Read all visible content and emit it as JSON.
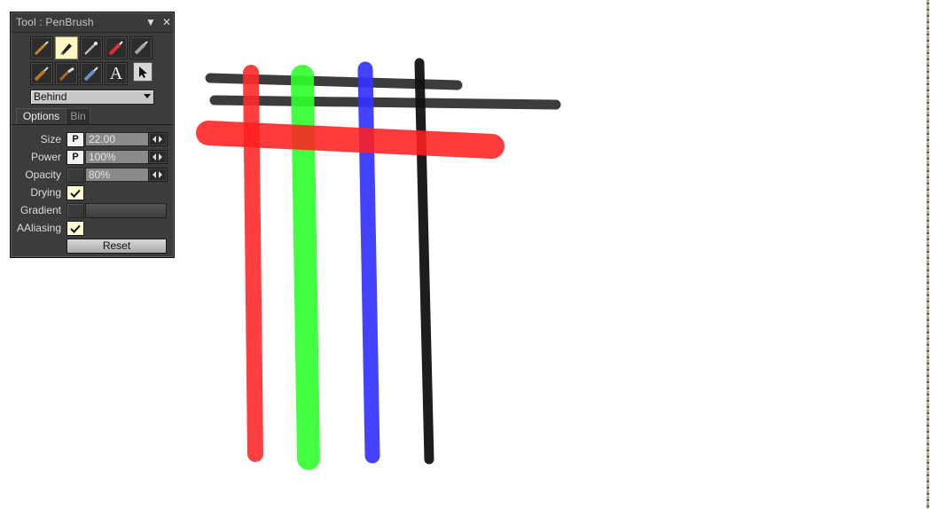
{
  "panel": {
    "title": "Tool : PenBrush",
    "menu_glyph": "▼",
    "close_glyph": "✕",
    "tools": [
      {
        "name": "brush-icon",
        "selected": false
      },
      {
        "name": "pen-icon",
        "selected": true
      },
      {
        "name": "airbrush-icon",
        "selected": false
      },
      {
        "name": "marker-icon",
        "selected": false
      },
      {
        "name": "eraser-icon",
        "selected": false
      },
      {
        "name": "flat-brush-icon",
        "selected": false
      },
      {
        "name": "knife-icon",
        "selected": false
      },
      {
        "name": "blur-icon",
        "selected": false
      },
      {
        "name": "text-icon",
        "selected": false,
        "glyph": "A"
      },
      {
        "name": "select-arrow-icon",
        "selected": false
      }
    ],
    "blend_mode": "Behind",
    "tabs": [
      "Options",
      "Bin"
    ],
    "active_tab": "Options",
    "size": {
      "label": "Size",
      "pressure": "P",
      "value": "22.00"
    },
    "power": {
      "label": "Power",
      "pressure": "P",
      "value": "100%"
    },
    "opacity": {
      "label": "Opacity",
      "value": "80%"
    },
    "drying": {
      "label": "Drying",
      "checked": true
    },
    "gradient": {
      "label": "Gradient"
    },
    "aaliasing": {
      "label": "AAliasing",
      "checked": true
    },
    "reset_label": "Reset"
  },
  "canvas": {
    "strokes": [
      {
        "name": "black-stroke-top-1",
        "color": "#2b2b2b"
      },
      {
        "name": "black-stroke-top-2",
        "color": "#2b2b2b"
      },
      {
        "name": "red-stroke-vertical",
        "color": "#ff3b3b"
      },
      {
        "name": "green-stroke-vertical",
        "color": "#3dff3d"
      },
      {
        "name": "blue-stroke-vertical",
        "color": "#3d3dff"
      },
      {
        "name": "black-stroke-vertical",
        "color": "#1a1a1a"
      },
      {
        "name": "red-stroke-horizontal",
        "color": "#ff2a2a"
      }
    ]
  }
}
